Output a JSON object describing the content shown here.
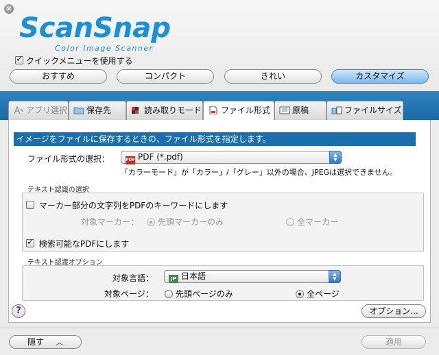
{
  "header": {
    "logo_main": "ScanSnap",
    "logo_sub": "Color Image Scanner",
    "quick_menu_label": "クイックメニューを使用する",
    "quick_menu_checked": true
  },
  "modes": [
    {
      "label": "おすすめ",
      "active": false
    },
    {
      "label": "コンパクト",
      "active": false
    },
    {
      "label": "きれい",
      "active": false
    },
    {
      "label": "カスタマイズ",
      "active": true
    }
  ],
  "tabs": [
    {
      "label": "アプリ選択",
      "icon": "app-select-icon",
      "state": "disabled"
    },
    {
      "label": "保存先",
      "icon": "folder-icon",
      "state": "normal"
    },
    {
      "label": "読み取りモード",
      "icon": "scan-mode-icon",
      "state": "normal"
    },
    {
      "label": "ファイル形式",
      "icon": "file-format-icon",
      "state": "active"
    },
    {
      "label": "原稿",
      "icon": "document-icon",
      "state": "normal"
    },
    {
      "label": "ファイルサイズ",
      "icon": "file-size-icon",
      "state": "normal"
    }
  ],
  "main": {
    "heading": "イメージをファイルに保存するときの、ファイル形式を指定します。",
    "format_label": "ファイル形式の選択：",
    "format_value": "PDF (*.pdf)",
    "format_icon_text": "PDF",
    "format_note": "「カラーモード」が「カラー」/「グレー」以外の場合、JPEGは選択できません。",
    "text_recognition": {
      "title": "テキスト認識の選択",
      "marker_keyword_label": "マーカー部分の文字列をPDFのキーワードにします",
      "marker_keyword_checked": false,
      "target_marker_label": "対象マーカー：",
      "first_marker_label": "先頭マーカーのみ",
      "all_marker_label": "全マーカー",
      "searchable_pdf_label": "検索可能なPDFにします",
      "searchable_pdf_checked": true
    },
    "ocr_options": {
      "title": "テキスト認識オプション",
      "language_label": "対象言語：",
      "language_value": "日本語",
      "language_icon_text": "JP",
      "pages_label": "対象ページ：",
      "first_page_label": "先頭ページのみ",
      "all_pages_label": "全ページ",
      "selected": "all"
    },
    "help_label": "?",
    "options_button": "オプション..."
  },
  "footer": {
    "hide_button": "隠す",
    "apply_button": "適用"
  },
  "colors": {
    "accent_blue": "#1b6fae",
    "band_blue": "#2e83bf",
    "logo_blue": "#1e8fd2"
  }
}
